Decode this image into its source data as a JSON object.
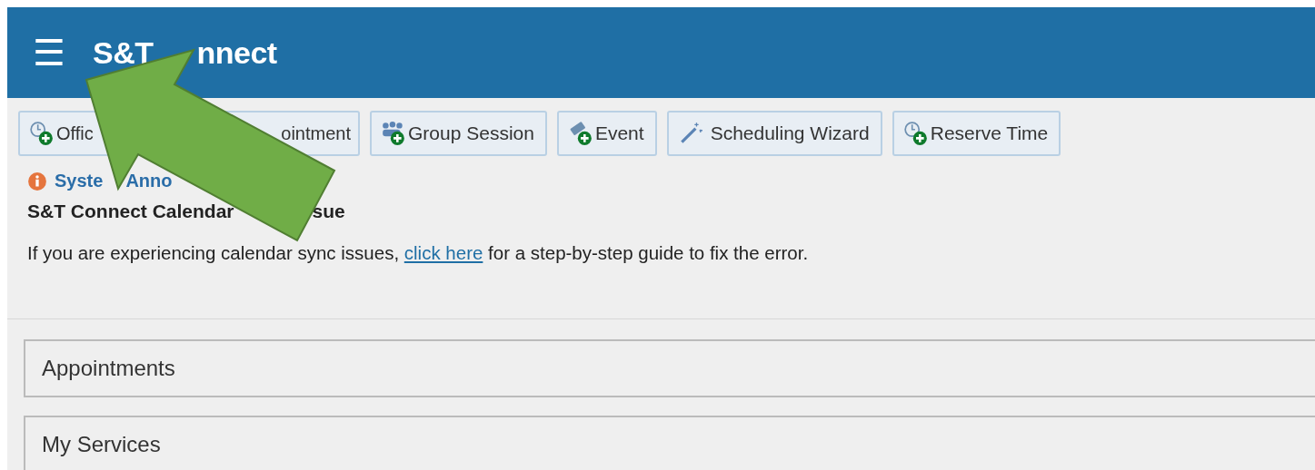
{
  "header": {
    "menu_icon": "☰",
    "title_parts": [
      "S&T",
      "nnect"
    ]
  },
  "toolbar": [
    {
      "kind": "split",
      "parts": [
        "Offic",
        "ointment"
      ]
    },
    {
      "kind": "plain",
      "label": "Group Session"
    },
    {
      "kind": "plain",
      "label": "Event"
    },
    {
      "kind": "plain",
      "label": "Scheduling Wizard"
    },
    {
      "kind": "plain",
      "label": "Reserve Time"
    }
  ],
  "announcement": {
    "title_parts": [
      "Syste",
      "Anno"
    ],
    "heading_parts": [
      "S&T Connect Calendar",
      "sue"
    ],
    "text_before": "If you are experiencing calendar sync issues, ",
    "link": "click here",
    "text_after": " for a step-by-step guide to fix the error."
  },
  "panels": [
    {
      "title": "Appointments"
    },
    {
      "title": "My Services"
    }
  ]
}
